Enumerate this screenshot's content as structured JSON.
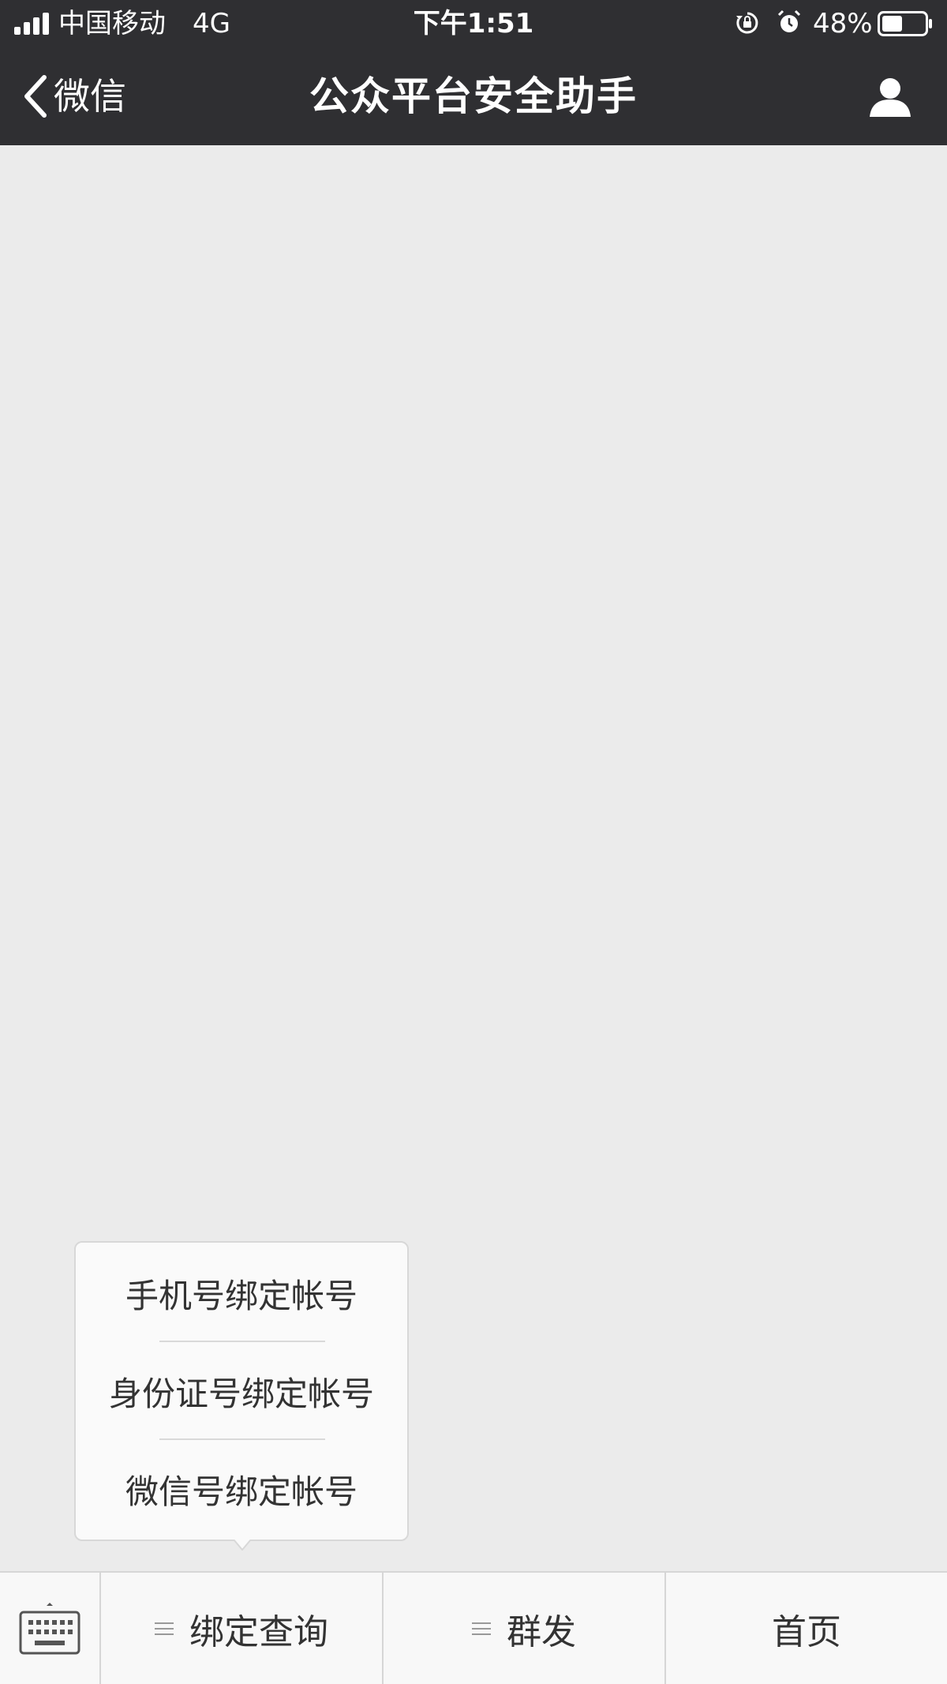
{
  "status_bar": {
    "carrier": "中国移动",
    "network": "4G",
    "time": "下午1:51",
    "battery_percent": "48%",
    "battery_level": 0.48,
    "icons": [
      "signal-icon",
      "rotation-lock-icon",
      "alarm-icon",
      "battery-icon"
    ]
  },
  "nav": {
    "back_label": "微信",
    "title": "公众平台安全助手",
    "right_icon": "profile-icon"
  },
  "popup_menu": {
    "items": [
      {
        "label": "手机号绑定帐号"
      },
      {
        "label": "身份证号绑定帐号"
      },
      {
        "label": "微信号绑定帐号"
      }
    ]
  },
  "bottom_menu": {
    "keyboard_icon": "keyboard-icon",
    "items": [
      {
        "label": "绑定查询",
        "has_submenu": true
      },
      {
        "label": "群发",
        "has_submenu": true
      },
      {
        "label": "首页",
        "has_submenu": false
      }
    ]
  },
  "colors": {
    "nav_bg": "#2f2f32",
    "content_bg": "#ebebeb",
    "menu_bg": "#f8f8f8",
    "text": "#333333"
  }
}
